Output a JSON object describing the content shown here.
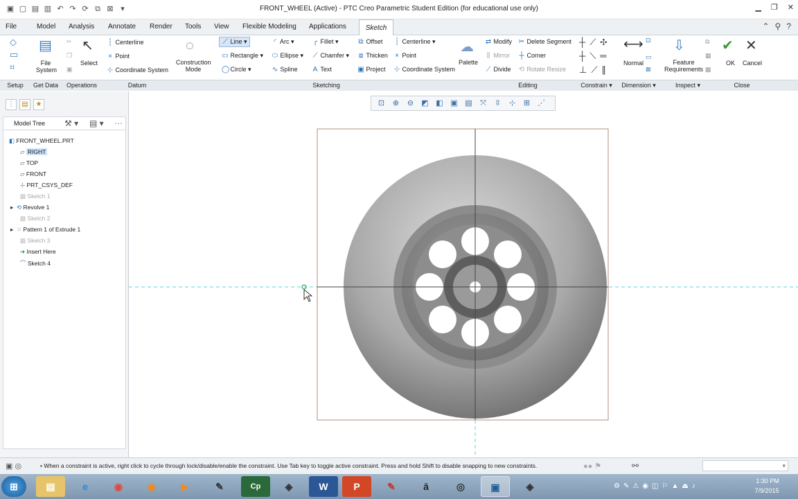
{
  "window": {
    "title": "FRONT_WHEEL (Active) - PTC Creo Parametric Student Edition (for educational use only)"
  },
  "tabs": [
    "File",
    "Model",
    "Analysis",
    "Annotate",
    "Render",
    "Tools",
    "View",
    "Flexible Modeling",
    "Applications",
    "Sketch"
  ],
  "ribbon": {
    "setup": {
      "file_system": "File System",
      "label": "Setup"
    },
    "get_data": {
      "label": "Get Data"
    },
    "operations": {
      "select": "Select",
      "label": "Operations"
    },
    "datum": {
      "centerline": "Centerline",
      "point": "Point",
      "coordinate_system": "Coordinate System",
      "label": "Datum"
    },
    "sketching": {
      "construction_mode": "Construction Mode",
      "line": "Line",
      "arc": "Arc",
      "fillet": "Fillet",
      "offset": "Offset",
      "rectangle": "Rectangle",
      "ellipse": "Ellipse",
      "chamfer": "Chamfer",
      "thicken": "Thicken",
      "circle": "Circle",
      "spline": "Spline",
      "text": "Text",
      "project": "Project",
      "centerline": "Centerline",
      "point": "Point",
      "coordinate_system": "Coordinate System",
      "palette": "Palette",
      "label": "Sketching"
    },
    "editing": {
      "modify": "Modify",
      "delete_segment": "Delete Segment",
      "mirror": "Mirror",
      "corner": "Corner",
      "divide": "Divide",
      "rotate_resize": "Rotate Resize",
      "label": "Editing"
    },
    "constrain": {
      "label": "Constrain"
    },
    "dimension": {
      "normal": "Normal",
      "label": "Dimension"
    },
    "inspect": {
      "feature_requirements": "Feature Requirements",
      "label": "Inspect"
    },
    "close": {
      "ok": "OK",
      "cancel": "Cancel",
      "label": "Close"
    }
  },
  "model_tree": {
    "title": "Model Tree",
    "items": [
      {
        "label": "FRONT_WHEEL.PRT"
      },
      {
        "label": "RIGHT"
      },
      {
        "label": "TOP"
      },
      {
        "label": "FRONT"
      },
      {
        "label": "PRT_CSYS_DEF"
      },
      {
        "label": "Sketch 1"
      },
      {
        "label": "Revolve 1"
      },
      {
        "label": "Sketch 2"
      },
      {
        "label": "Pattern 1 of Extrude 1"
      },
      {
        "label": "Sketch 3"
      },
      {
        "label": "Insert Here"
      },
      {
        "label": "Sketch 4"
      }
    ]
  },
  "status": {
    "message": "When a constraint is active, right click to cycle through lock/disable/enable the constraint. Use Tab key to toggle active constraint. Press and hold Shift to disable snapping to new constraints."
  },
  "taskbar": {
    "time": "1:30 PM",
    "date": "7/9/2015"
  },
  "colors": {
    "accent": "#2a72b8",
    "taskbar": "#8aa3bb",
    "ok_green": "#3c9a2e"
  }
}
